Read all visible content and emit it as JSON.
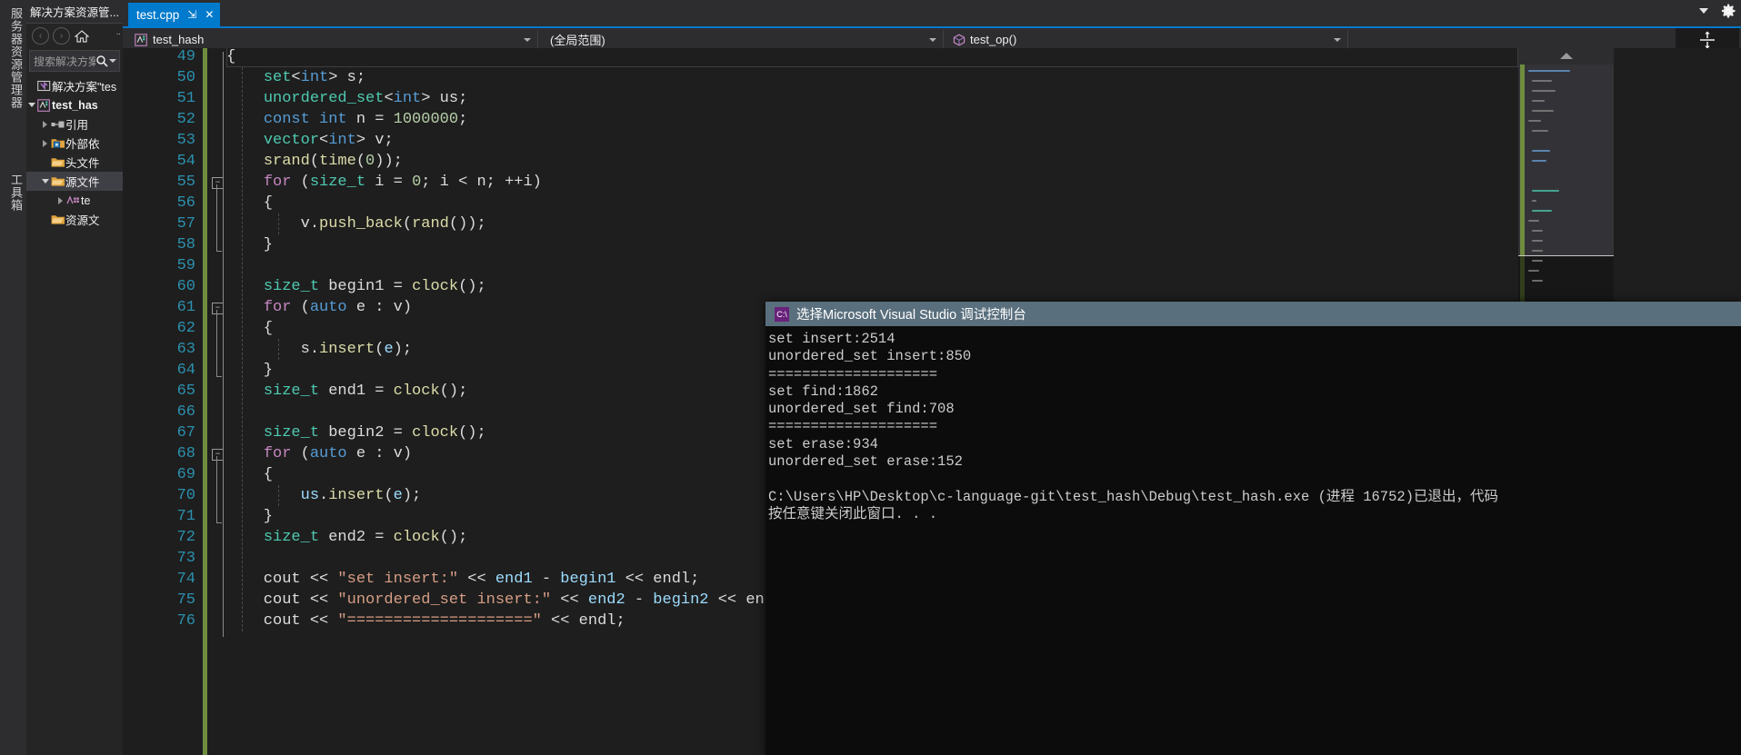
{
  "vertical_dock": {
    "tabs": [
      {
        "label": "服务器资源管理器",
        "name": "server-explorer"
      },
      {
        "label": "工具箱",
        "name": "toolbox"
      }
    ]
  },
  "solution_explorer": {
    "title": "解决方案资源管... ",
    "toolbar": {
      "back_label": "‹",
      "forward_label": "›",
      "home_name": "home-icon",
      "overflow_label": "··"
    },
    "search": {
      "placeholder": "搜索解决方案",
      "value": "搜索解决方案"
    },
    "tree": [
      {
        "label": "解决方案\"tes",
        "icon": "solution-icon",
        "indent": 0,
        "twisty": "none",
        "bold": false,
        "selected": false
      },
      {
        "label": "test_has",
        "icon": "project-icon",
        "indent": 0,
        "twisty": "open",
        "bold": true,
        "selected": false
      },
      {
        "label": "引用",
        "icon": "references-icon",
        "indent": 1,
        "twisty": "closed",
        "bold": false,
        "selected": false
      },
      {
        "label": "外部依",
        "icon": "external-deps-icon",
        "indent": 1,
        "twisty": "closed",
        "bold": false,
        "selected": false
      },
      {
        "label": "头文件",
        "icon": "folder-icon",
        "indent": 1,
        "twisty": "none",
        "bold": false,
        "selected": false
      },
      {
        "label": "源文件",
        "icon": "folder-icon",
        "indent": 1,
        "twisty": "open",
        "bold": false,
        "selected": true
      },
      {
        "label": "te",
        "icon": "cpp-file-icon",
        "indent": 2,
        "twisty": "closed",
        "bold": false,
        "selected": false
      },
      {
        "label": "资源文",
        "icon": "folder-icon",
        "indent": 1,
        "twisty": "none",
        "bold": false,
        "selected": false
      }
    ]
  },
  "tabstrip": {
    "active_tab": "test.cpp",
    "pin_label": "⇲",
    "close_label": "✕"
  },
  "navbar": {
    "project_selector": "test_hash",
    "scope_selector": "(全局范围)",
    "member_selector": "test_op()",
    "split_label": "⇳"
  },
  "editor": {
    "first_line": 49,
    "current_line": 49,
    "lines": [
      {
        "n": 49,
        "indent": 0,
        "fold": false,
        "tokens": [
          {
            "t": "{",
            "c": "p"
          }
        ]
      },
      {
        "n": 50,
        "indent": 0,
        "fold": false,
        "tokens": [
          {
            "t": "    ",
            "c": "p"
          },
          {
            "t": "set",
            "c": "t"
          },
          {
            "t": "<",
            "c": "p"
          },
          {
            "t": "int",
            "c": "k"
          },
          {
            "t": "> ",
            "c": "p"
          },
          {
            "t": "s",
            "c": "p"
          },
          {
            "t": ";",
            "c": "p"
          }
        ]
      },
      {
        "n": 51,
        "indent": 0,
        "fold": false,
        "tokens": [
          {
            "t": "    ",
            "c": "p"
          },
          {
            "t": "unordered_set",
            "c": "t"
          },
          {
            "t": "<",
            "c": "p"
          },
          {
            "t": "int",
            "c": "k"
          },
          {
            "t": "> ",
            "c": "p"
          },
          {
            "t": "us",
            "c": "p"
          },
          {
            "t": ";",
            "c": "p"
          }
        ]
      },
      {
        "n": 52,
        "indent": 0,
        "fold": false,
        "tokens": [
          {
            "t": "    ",
            "c": "p"
          },
          {
            "t": "const",
            "c": "k"
          },
          {
            "t": " ",
            "c": "p"
          },
          {
            "t": "int",
            "c": "k"
          },
          {
            "t": " n = ",
            "c": "p"
          },
          {
            "t": "1000000",
            "c": "n"
          },
          {
            "t": ";",
            "c": "p"
          }
        ]
      },
      {
        "n": 53,
        "indent": 0,
        "fold": false,
        "tokens": [
          {
            "t": "    ",
            "c": "p"
          },
          {
            "t": "vector",
            "c": "t"
          },
          {
            "t": "<",
            "c": "p"
          },
          {
            "t": "int",
            "c": "k"
          },
          {
            "t": "> ",
            "c": "p"
          },
          {
            "t": "v",
            "c": "p"
          },
          {
            "t": ";",
            "c": "p"
          }
        ]
      },
      {
        "n": 54,
        "indent": 0,
        "fold": false,
        "tokens": [
          {
            "t": "    ",
            "c": "p"
          },
          {
            "t": "srand",
            "c": "f"
          },
          {
            "t": "(",
            "c": "p"
          },
          {
            "t": "time",
            "c": "f"
          },
          {
            "t": "(",
            "c": "p"
          },
          {
            "t": "0",
            "c": "n"
          },
          {
            "t": "));",
            "c": "p"
          }
        ]
      },
      {
        "n": 55,
        "indent": 0,
        "fold": true,
        "tokens": [
          {
            "t": "    ",
            "c": "p"
          },
          {
            "t": "for",
            "c": "kc"
          },
          {
            "t": " (",
            "c": "p"
          },
          {
            "t": "size_t",
            "c": "t"
          },
          {
            "t": " i = ",
            "c": "p"
          },
          {
            "t": "0",
            "c": "n"
          },
          {
            "t": "; i < n; ++i)",
            "c": "p"
          }
        ]
      },
      {
        "n": 56,
        "indent": 0,
        "fold": false,
        "tokens": [
          {
            "t": "    {",
            "c": "p"
          }
        ]
      },
      {
        "n": 57,
        "indent": 0,
        "fold": false,
        "tokens": [
          {
            "t": "        v.",
            "c": "p"
          },
          {
            "t": "push_back",
            "c": "f"
          },
          {
            "t": "(",
            "c": "p"
          },
          {
            "t": "rand",
            "c": "f"
          },
          {
            "t": "());",
            "c": "p"
          }
        ]
      },
      {
        "n": 58,
        "indent": 0,
        "fold": false,
        "tokens": [
          {
            "t": "    }",
            "c": "p"
          }
        ]
      },
      {
        "n": 59,
        "indent": 0,
        "fold": false,
        "tokens": []
      },
      {
        "n": 60,
        "indent": 0,
        "fold": false,
        "tokens": [
          {
            "t": "    ",
            "c": "p"
          },
          {
            "t": "size_t",
            "c": "t"
          },
          {
            "t": " begin1 = ",
            "c": "p"
          },
          {
            "t": "clock",
            "c": "f"
          },
          {
            "t": "();",
            "c": "p"
          }
        ]
      },
      {
        "n": 61,
        "indent": 0,
        "fold": true,
        "tokens": [
          {
            "t": "    ",
            "c": "p"
          },
          {
            "t": "for",
            "c": "kc"
          },
          {
            "t": " (",
            "c": "p"
          },
          {
            "t": "auto",
            "c": "k"
          },
          {
            "t": " e : v)",
            "c": "p"
          }
        ]
      },
      {
        "n": 62,
        "indent": 0,
        "fold": false,
        "tokens": [
          {
            "t": "    {",
            "c": "p"
          }
        ]
      },
      {
        "n": 63,
        "indent": 0,
        "fold": false,
        "tokens": [
          {
            "t": "        s.",
            "c": "p"
          },
          {
            "t": "insert",
            "c": "f"
          },
          {
            "t": "(",
            "c": "p"
          },
          {
            "t": "e",
            "c": "v"
          },
          {
            "t": ");",
            "c": "p"
          }
        ]
      },
      {
        "n": 64,
        "indent": 0,
        "fold": false,
        "tokens": [
          {
            "t": "    }",
            "c": "p"
          }
        ]
      },
      {
        "n": 65,
        "indent": 0,
        "fold": false,
        "tokens": [
          {
            "t": "    ",
            "c": "p"
          },
          {
            "t": "size_t",
            "c": "t"
          },
          {
            "t": " end1 = ",
            "c": "p"
          },
          {
            "t": "clock",
            "c": "f"
          },
          {
            "t": "();",
            "c": "p"
          }
        ]
      },
      {
        "n": 66,
        "indent": 0,
        "fold": false,
        "tokens": []
      },
      {
        "n": 67,
        "indent": 0,
        "fold": false,
        "tokens": [
          {
            "t": "    ",
            "c": "p"
          },
          {
            "t": "size_t",
            "c": "t"
          },
          {
            "t": " begin2 = ",
            "c": "p"
          },
          {
            "t": "clock",
            "c": "f"
          },
          {
            "t": "();",
            "c": "p"
          }
        ]
      },
      {
        "n": 68,
        "indent": 0,
        "fold": true,
        "tokens": [
          {
            "t": "    ",
            "c": "p"
          },
          {
            "t": "for",
            "c": "kc"
          },
          {
            "t": " (",
            "c": "p"
          },
          {
            "t": "auto",
            "c": "k"
          },
          {
            "t": " e : v)",
            "c": "p"
          }
        ]
      },
      {
        "n": 69,
        "indent": 0,
        "fold": false,
        "tokens": [
          {
            "t": "    {",
            "c": "p"
          }
        ]
      },
      {
        "n": 70,
        "indent": 0,
        "fold": false,
        "tokens": [
          {
            "t": "        ",
            "c": "p"
          },
          {
            "t": "us",
            "c": "v"
          },
          {
            "t": ".",
            "c": "p"
          },
          {
            "t": "insert",
            "c": "f"
          },
          {
            "t": "(",
            "c": "p"
          },
          {
            "t": "e",
            "c": "v"
          },
          {
            "t": ");",
            "c": "p"
          }
        ]
      },
      {
        "n": 71,
        "indent": 0,
        "fold": false,
        "tokens": [
          {
            "t": "    }",
            "c": "p"
          }
        ]
      },
      {
        "n": 72,
        "indent": 0,
        "fold": false,
        "tokens": [
          {
            "t": "    ",
            "c": "p"
          },
          {
            "t": "size_t",
            "c": "t"
          },
          {
            "t": " end2 = ",
            "c": "p"
          },
          {
            "t": "clock",
            "c": "f"
          },
          {
            "t": "();",
            "c": "p"
          }
        ]
      },
      {
        "n": 73,
        "indent": 0,
        "fold": false,
        "tokens": []
      },
      {
        "n": 74,
        "indent": 0,
        "fold": false,
        "tokens": [
          {
            "t": "    cout << ",
            "c": "p"
          },
          {
            "t": "\"set insert:\"",
            "c": "s"
          },
          {
            "t": " << ",
            "c": "p"
          },
          {
            "t": "end1",
            "c": "v"
          },
          {
            "t": " - ",
            "c": "p"
          },
          {
            "t": "begin1",
            "c": "v"
          },
          {
            "t": " << endl;",
            "c": "p"
          }
        ]
      },
      {
        "n": 75,
        "indent": 0,
        "fold": false,
        "tokens": [
          {
            "t": "    cout << ",
            "c": "p"
          },
          {
            "t": "\"unordered_set insert:\"",
            "c": "s"
          },
          {
            "t": " << ",
            "c": "p"
          },
          {
            "t": "end2",
            "c": "v"
          },
          {
            "t": " - ",
            "c": "p"
          },
          {
            "t": "begin2",
            "c": "v"
          },
          {
            "t": " << endl;",
            "c": "p"
          }
        ]
      },
      {
        "n": 76,
        "indent": 0,
        "fold": false,
        "tokens": [
          {
            "t": "    cout << ",
            "c": "p"
          },
          {
            "t": "\"====================\"",
            "c": "s"
          },
          {
            "t": " << endl;",
            "c": "p"
          }
        ]
      }
    ]
  },
  "console": {
    "title": "选择Microsoft Visual Studio 调试控制台",
    "icon_label": "C:\\",
    "output": [
      "set insert:2514",
      "unordered_set insert:850",
      "====================",
      "set find:1862",
      "unordered_set find:708",
      "====================",
      "set erase:934",
      "unordered_set erase:152",
      "",
      "C:\\Users\\HP\\Desktop\\c-language-git\\test_hash\\Debug\\test_hash.exe (进程 16752)已退出，代码",
      "按任意键关闭此窗口. . ."
    ]
  },
  "colors": {
    "accent": "#007acc",
    "console_title_bg": "#5a6f7d",
    "changebar": "#6f8c3f",
    "line_number": "#2b91af"
  }
}
